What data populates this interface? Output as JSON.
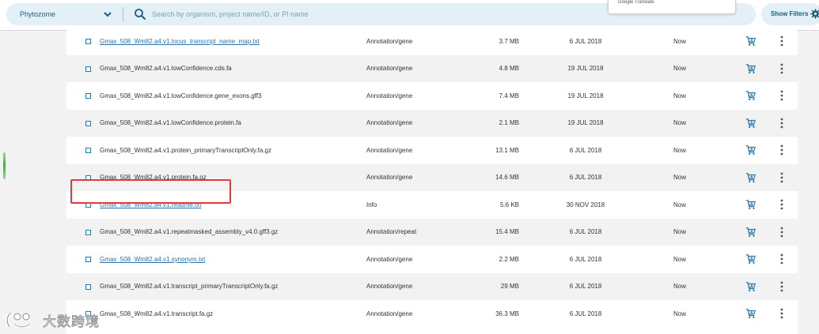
{
  "search": {
    "organism": "Phytozome",
    "placeholder": "Search by organism, project name/ID, or PI name"
  },
  "translate_popup": {
    "label": "Google Translate"
  },
  "filters_button": {
    "label": "Show Filters"
  },
  "files": [
    {
      "name": "Gmax_508_Wm82.a4.v1.locus_transcript_name_map.txt",
      "link": true,
      "type": "Annotation/gene",
      "size": "3.7 MB",
      "date": "6 JUL 2018",
      "availability": "Now"
    },
    {
      "name": "Gmax_508_Wm82.a4.v1.lowConfidence.cds.fa",
      "link": false,
      "type": "Annotation/gene",
      "size": "4.8 MB",
      "date": "19 JUL 2018",
      "availability": "Now"
    },
    {
      "name": "Gmax_508_Wm82.a4.v1.lowConfidence.gene_exons.gff3",
      "link": false,
      "type": "Annotation/gene",
      "size": "7.4 MB",
      "date": "19 JUL 2018",
      "availability": "Now"
    },
    {
      "name": "Gmax_508_Wm82.a4.v1.lowConfidence.protein.fa",
      "link": false,
      "type": "Annotation/gene",
      "size": "2.1 MB",
      "date": "19 JUL 2018",
      "availability": "Now"
    },
    {
      "name": "Gmax_508_Wm82.a4.v1.protein_primaryTranscriptOnly.fa.gz",
      "link": false,
      "type": "Annotation/gene",
      "size": "13.1 MB",
      "date": "6 JUL 2018",
      "availability": "Now"
    },
    {
      "name": "Gmax_508_Wm82.a4.v1.protein.fa.gz",
      "link": false,
      "type": "Annotation/gene",
      "size": "14.6 MB",
      "date": "6 JUL 2018",
      "availability": "Now"
    },
    {
      "name": "Gmax_508_Wm82.a4.v1.readme.txt",
      "link": true,
      "type": "Info",
      "size": "5.6 KB",
      "date": "30 NOV 2018",
      "availability": "Now"
    },
    {
      "name": "Gmax_508_Wm82.a4.v1.repeatmasked_assembly_v4.0.gff3.gz",
      "link": false,
      "type": "Annotation/repeat",
      "size": "15.4 MB",
      "date": "6 JUL 2018",
      "availability": "Now"
    },
    {
      "name": "Gmax_508_Wm82.a4.v1.synonym.txt",
      "link": true,
      "type": "Annotation/gene",
      "size": "2.2 MB",
      "date": "6 JUL 2018",
      "availability": "Now"
    },
    {
      "name": "Gmax_508_Wm82.a4.v1.transcript_primaryTranscriptOnly.fa.gz",
      "link": false,
      "type": "Annotation/gene",
      "size": "29 MB",
      "date": "6 JUL 2018",
      "availability": "Now"
    },
    {
      "name": "Gmax_508_Wm82.a4.v1.transcript.fa.gz",
      "link": false,
      "type": "Annotation/gene",
      "size": "36.3 MB",
      "date": "6 JUL 2018",
      "availability": "Now"
    }
  ],
  "watermark": {
    "text": "大数跨境"
  },
  "colors": {
    "accent": "#2a78a8",
    "link": "#2a6fb0",
    "highlight": "#e03a3a",
    "search_bg": "#e3f0f6"
  },
  "icons": [
    "chevron-down-icon",
    "search-icon",
    "gear-icon",
    "cart-icon",
    "kebab-menu-icon"
  ]
}
